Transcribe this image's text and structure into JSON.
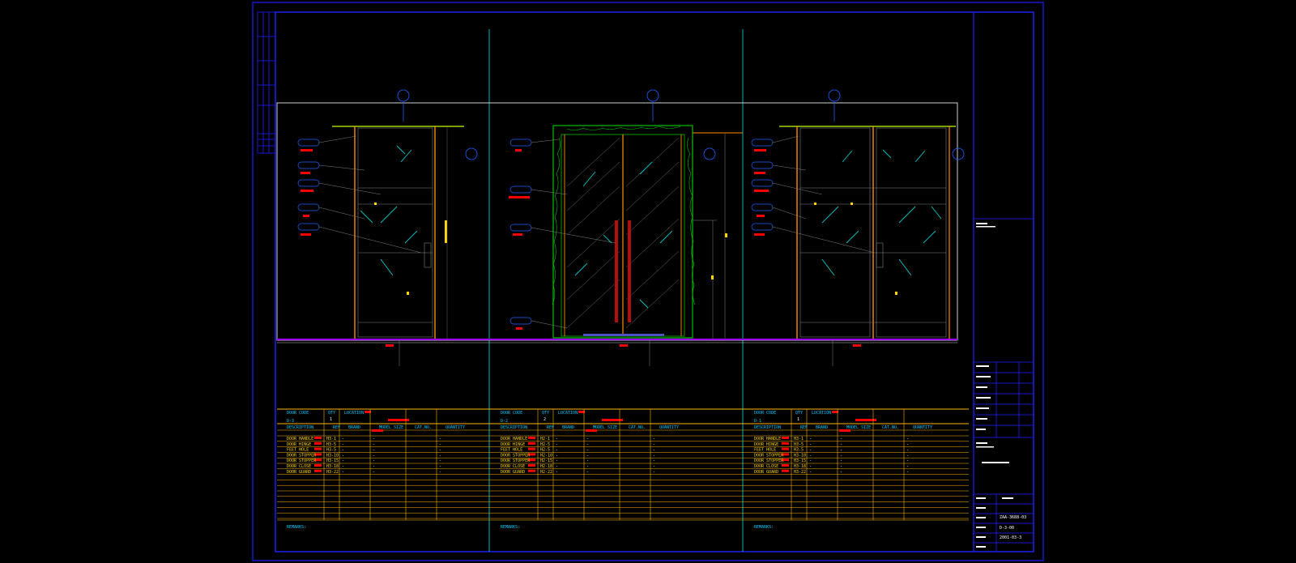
{
  "colors": {
    "background": "#000000",
    "frame": "#0000ff",
    "wall": "#ffffff",
    "door_frame": "#ff8c00",
    "glass": "#00c8c8",
    "table_lines": "#ffb400",
    "labels": "#ffd400",
    "cyan_text": "#00c8ff",
    "redline": "#ff0000",
    "floor": "#a000ff",
    "marble": "#00c000"
  },
  "panels": [
    {
      "door_code_label": "DOOR CODE",
      "door_code": "D-3",
      "qty_label": "QTY",
      "qty": "1",
      "location_label": "LOCATION",
      "headers": [
        "DESCRIPTION",
        "REF",
        "BRAND",
        "MODEL SIZE",
        "CAT.NO.",
        "QUANTITY"
      ],
      "rows": [
        [
          "DOOR HANDLE",
          "H3-1",
          "-",
          "-",
          "",
          "-"
        ],
        [
          "DOOR HINGE",
          "H3-5",
          "-",
          "-",
          "",
          "-"
        ],
        [
          "FEET HOLE",
          "H3-5",
          "-",
          "-",
          "",
          "-"
        ],
        [
          "DOOR STOPPER",
          "H3-10",
          "-",
          "-",
          "",
          "-"
        ],
        [
          "DOOR STOPPER",
          "H3-15",
          "-",
          "-",
          "",
          "-"
        ],
        [
          "DOOR CLOSE",
          "H3-18",
          "-",
          "-",
          "",
          "-"
        ],
        [
          "DOOR GUARD",
          "H3-22",
          "-",
          "-",
          "",
          "-"
        ]
      ],
      "remarks_label": "REMARKS:"
    },
    {
      "door_code_label": "DOOR CODE",
      "door_code": "D-2",
      "qty_label": "QTY",
      "qty": "2",
      "location_label": "LOCATION",
      "headers": [
        "DESCRIPTION",
        "REF",
        "BRAND",
        "MODEL SIZE",
        "CAT.NO.",
        "QUANTITY"
      ],
      "rows": [
        [
          "DOOR HANDLE",
          "H2-1",
          "-",
          "-",
          "",
          "-"
        ],
        [
          "DOOR HINGE",
          "H2-5",
          "-",
          "-",
          "",
          "-"
        ],
        [
          "FEET HOLE",
          "H2-5",
          "-",
          "-",
          "",
          "-"
        ],
        [
          "DOOR STOPPER",
          "H2-10",
          "-",
          "-",
          "",
          "-"
        ],
        [
          "DOOR STOPPER",
          "H2-15",
          "-",
          "-",
          "",
          "-"
        ],
        [
          "DOOR CLOSE",
          "H2-18",
          "-",
          "-",
          "",
          "-"
        ],
        [
          "DOOR GUARD",
          "H2-22",
          "-",
          "-",
          "",
          "-"
        ]
      ],
      "remarks_label": "REMARKS:"
    },
    {
      "door_code_label": "DOOR CODE",
      "door_code": "D-1",
      "qty_label": "QTY",
      "qty": "1",
      "location_label": "LOCATION",
      "headers": [
        "DESCRIPTION",
        "REF",
        "BRAND",
        "MODEL SIZE",
        "CAT.NO.",
        "QUANTITY"
      ],
      "rows": [
        [
          "DOOR HANDLE",
          "H3-1",
          "-",
          "-",
          "",
          "-"
        ],
        [
          "DOOR HINGE",
          "H3-5",
          "-",
          "-",
          "",
          "-"
        ],
        [
          "FEET HOLE",
          "H3-5",
          "-",
          "-",
          "",
          "-"
        ],
        [
          "DOOR STOPPER",
          "H3-10",
          "-",
          "-",
          "",
          "-"
        ],
        [
          "DOOR STOPPER",
          "H3-15",
          "-",
          "-",
          "",
          "-"
        ],
        [
          "DOOR CLOSE",
          "H3-18",
          "-",
          "-",
          "",
          "-"
        ],
        [
          "DOOR GUARD",
          "H3-22",
          "-",
          "-",
          "",
          "-"
        ]
      ],
      "remarks_label": "REMARKS:"
    }
  ],
  "title_block": {
    "drawing_no": "ZAA-3688-03",
    "sheet": "D-3-00",
    "date": "2001-03-3"
  }
}
